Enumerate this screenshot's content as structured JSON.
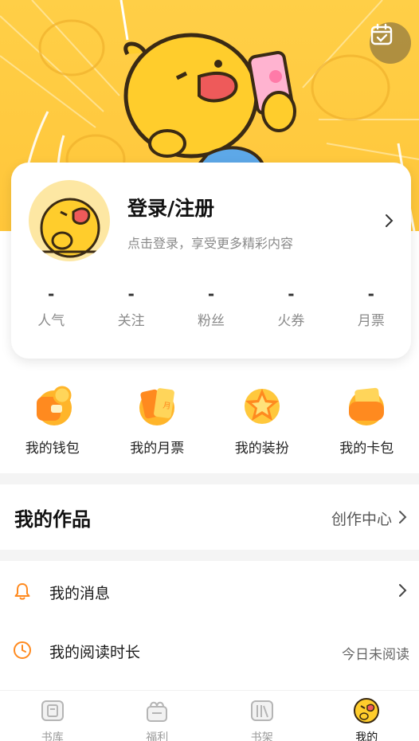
{
  "header": {
    "calendar_icon": "calendar-check-icon",
    "accent_color": "#FFC83C"
  },
  "profile": {
    "title": "登录/注册",
    "subtitle": "点击登录，享受更多精彩内容",
    "stats": [
      {
        "value": "-",
        "label": "人气"
      },
      {
        "value": "-",
        "label": "关注"
      },
      {
        "value": "-",
        "label": "粉丝"
      },
      {
        "value": "-",
        "label": "火券"
      },
      {
        "value": "-",
        "label": "月票"
      }
    ]
  },
  "quick_actions": [
    {
      "label": "我的钱包",
      "icon": "wallet-icon"
    },
    {
      "label": "我的月票",
      "icon": "monthly-ticket-icon"
    },
    {
      "label": "我的装扮",
      "icon": "dressup-star-icon"
    },
    {
      "label": "我的卡包",
      "icon": "card-pack-icon"
    }
  ],
  "works": {
    "title": "我的作品",
    "link_label": "创作中心"
  },
  "list": {
    "messages": {
      "label": "我的消息",
      "icon": "bell-icon"
    },
    "reading_time": {
      "label": "我的阅读时长",
      "icon": "clock-icon",
      "value": "今日未阅读"
    }
  },
  "bottom_nav": [
    {
      "label": "书库",
      "icon": "library-icon",
      "active": false
    },
    {
      "label": "福利",
      "icon": "gift-icon",
      "active": false
    },
    {
      "label": "书架",
      "icon": "bookshelf-icon",
      "active": false
    },
    {
      "label": "我的",
      "icon": "avatar-icon",
      "active": true
    }
  ],
  "colors": {
    "brand_orange": "#FF8A1F",
    "banner_yellow": "#FFC83C",
    "muted_text": "#8A8A8A"
  }
}
